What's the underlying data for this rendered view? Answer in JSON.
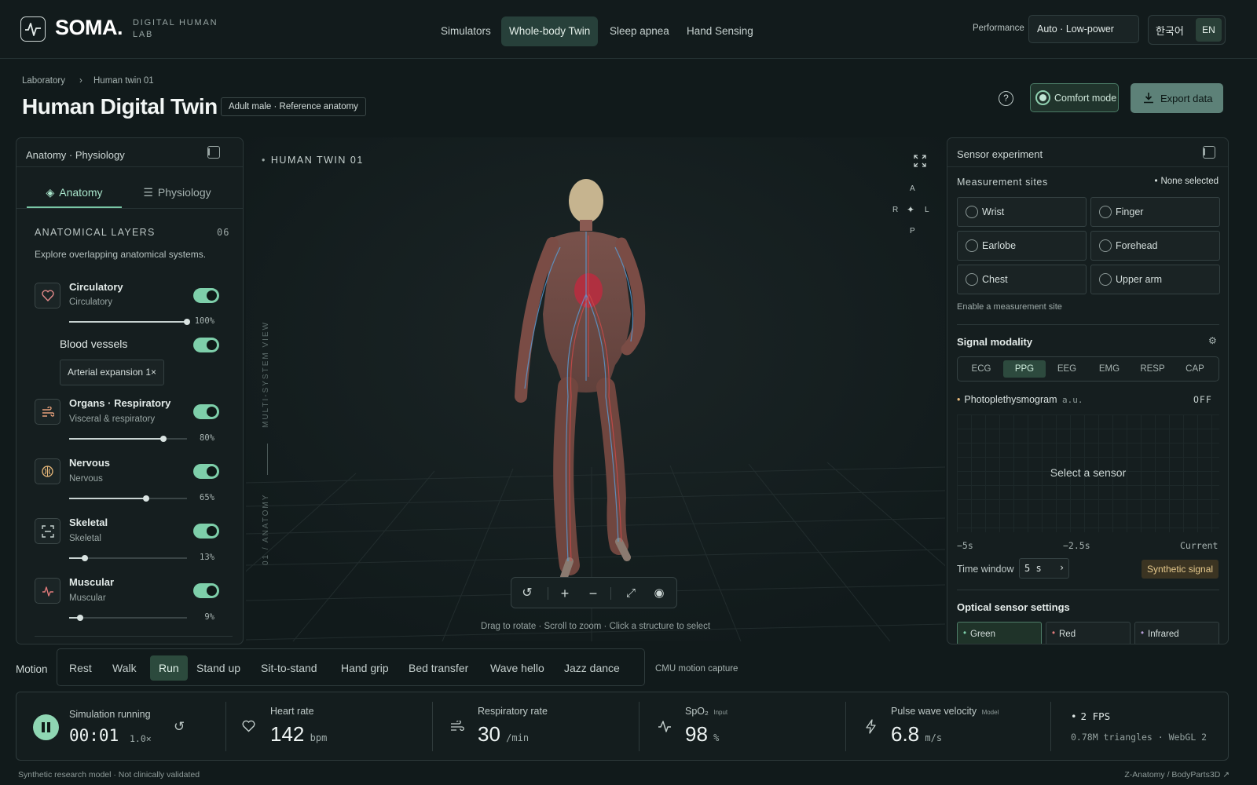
{
  "header": {
    "brand": "SOMA.",
    "brand_sub": "DIGITAL HUMAN LAB",
    "nav": [
      "Simulators",
      "Whole-body Twin",
      "Sleep apnea",
      "Hand Sensing"
    ],
    "nav_active": "Whole-body Twin",
    "performance_label": "Performance",
    "performance_value": "Auto · Low-power",
    "lang_ko": "한국어",
    "lang_en": "EN"
  },
  "page": {
    "breadcrumb": [
      "Laboratory",
      "Human twin 01"
    ],
    "title": "Human Digital Twin",
    "tag": "Adult male · Reference anatomy",
    "help": "?",
    "comfort_label": "Comfort mode",
    "export_label": "Export data"
  },
  "left_panel": {
    "title": "Anatomy · Physiology",
    "tabs": [
      "Anatomy",
      "Physiology"
    ],
    "layers_heading": "ANATOMICAL LAYERS",
    "layers_count": "06",
    "layers_desc": "Explore overlapping anatomical systems.",
    "layers": [
      {
        "name": "Circulatory",
        "sub": "Circulatory",
        "pct": "100%",
        "value": 1.0,
        "icon": "heart-icon"
      },
      {
        "name": "Organs · Respiratory",
        "sub": "Visceral & respiratory",
        "pct": "80%",
        "value": 0.8,
        "icon": "wind-icon"
      },
      {
        "name": "Nervous",
        "sub": "Nervous",
        "pct": "65%",
        "value": 0.65,
        "icon": "brain-icon"
      },
      {
        "name": "Skeletal",
        "sub": "Skeletal",
        "pct": "13%",
        "value": 0.13,
        "icon": "scan-icon"
      },
      {
        "name": "Muscular",
        "sub": "Muscular",
        "pct": "9%",
        "value": 0.09,
        "icon": "pulse-icon"
      }
    ],
    "blood_vessels": "Blood vessels",
    "arterial": "Arterial expansion 1×"
  },
  "viewer": {
    "label": "HUMAN TWIN 01",
    "vertical_1": "MULTI-SYSTEM VIEW",
    "vertical_2": "01 / ANATOMY",
    "compass": {
      "a": "A",
      "r": "R",
      "l": "L",
      "p": "P"
    },
    "hint": "Drag to rotate  ·  Scroll to zoom  ·  Click a structure to select"
  },
  "right_panel": {
    "title": "Sensor experiment",
    "sites_heading": "Measurement sites",
    "sites_status": "None selected",
    "sites": [
      "Wrist",
      "Finger",
      "Earlobe",
      "Forehead",
      "Chest",
      "Upper arm"
    ],
    "sites_hint": "Enable a measurement site",
    "modality_heading": "Signal modality",
    "modalities": [
      "ECG",
      "PPG",
      "EEG",
      "EMG",
      "RESP",
      "CAP"
    ],
    "modality_active": "PPG",
    "signal_name": "Photoplethysmogram",
    "signal_unit": "a.u.",
    "signal_state": "OFF",
    "graph_msg": "Select a sensor",
    "axis": [
      "−5s",
      "−2.5s",
      "Current"
    ],
    "time_window_label": "Time window",
    "time_window_value": "5 s",
    "synthetic": "Synthetic signal",
    "optical_heading": "Optical sensor settings",
    "optical": [
      "Green",
      "Red",
      "Infrared"
    ]
  },
  "motion": {
    "label": "Motion",
    "items": [
      "Rest",
      "Walk",
      "Run",
      "Stand up",
      "Sit-to-stand",
      "Hand grip",
      "Bed transfer",
      "Wave hello",
      "Jazz dance"
    ],
    "active": "Run",
    "source": "CMU motion capture"
  },
  "stats": {
    "sim_label": "Simulation running",
    "sim_time": "00:01",
    "sim_speed": "1.0×",
    "hr_label": "Heart rate",
    "hr_value": "142",
    "hr_unit": "bpm",
    "rr_label": "Respiratory rate",
    "rr_value": "30",
    "rr_unit": "/min",
    "spo2_label": "SpO₂",
    "spo2_tag": "Input",
    "spo2_value": "98",
    "spo2_unit": "%",
    "pwv_label": "Pulse wave velocity",
    "pwv_tag": "Model",
    "pwv_value": "6.8",
    "pwv_unit": "m/s",
    "fps": "2 FPS",
    "render_info": "0.78M triangles · WebGL 2"
  },
  "footer": {
    "left": "Synthetic research model · Not clinically validated",
    "right": "Z-Anatomy / BodyParts3D ↗"
  },
  "colors": {
    "accent": "#7ecfaa",
    "background": "#111a1b"
  }
}
